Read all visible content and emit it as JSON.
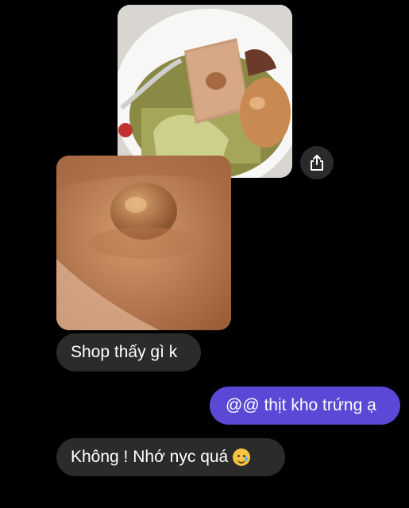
{
  "messages": [
    {
      "text": "Shop thấy gì k",
      "direction": "received"
    },
    {
      "text": "@@ thịt kho trứng ạ",
      "direction": "sent"
    },
    {
      "text": "Không ! Nhớ nyc quá",
      "emoji": "smiling-face-with-tear",
      "direction": "received"
    }
  ],
  "icons": {
    "share": "share-icon"
  },
  "colors": {
    "background": "#000000",
    "received_bubble": "#2b2b2b",
    "sent_bubble": "#5b48d6",
    "text": "#ffffff"
  }
}
